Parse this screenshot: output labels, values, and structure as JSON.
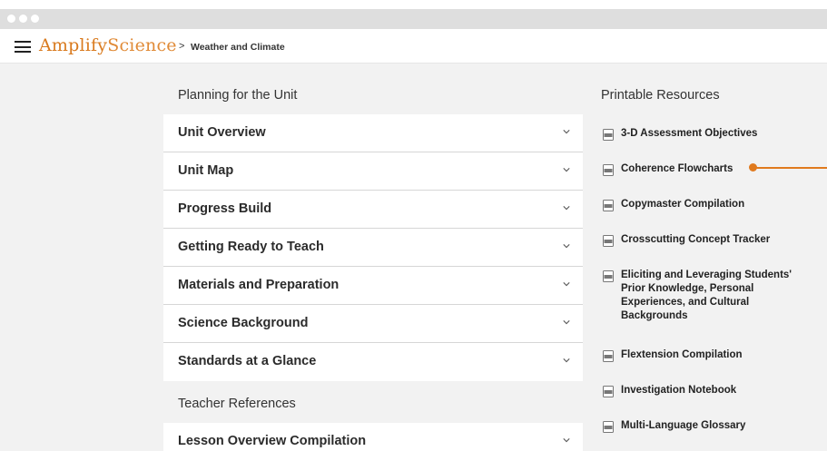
{
  "app": {
    "logo_primary": "Amplify",
    "logo_secondary": "Science",
    "breadcrumb_separator": ">",
    "breadcrumb": "Weather and Climate"
  },
  "planning": {
    "heading": "Planning for the Unit",
    "items": [
      {
        "label": "Unit Overview"
      },
      {
        "label": "Unit Map"
      },
      {
        "label": "Progress Build"
      },
      {
        "label": "Getting Ready to Teach"
      },
      {
        "label": "Materials and Preparation"
      },
      {
        "label": "Science Background"
      },
      {
        "label": "Standards at a Glance"
      }
    ]
  },
  "teacher": {
    "heading": "Teacher References",
    "items": [
      {
        "label": "Lesson Overview Compilation"
      }
    ]
  },
  "printable": {
    "heading": "Printable Resources",
    "items": [
      {
        "label": "3-D Assessment Objectives"
      },
      {
        "label": "Coherence Flowcharts"
      },
      {
        "label": "Copymaster Compilation"
      },
      {
        "label": "Crosscutting Concept Tracker"
      },
      {
        "label": "Eliciting and Leveraging Students' Prior Knowledge, Personal Experiences, and Cultural Backgrounds"
      },
      {
        "label": "Flextension Compilation"
      },
      {
        "label": "Investigation Notebook"
      },
      {
        "label": "Multi-Language Glossary"
      }
    ]
  },
  "colors": {
    "brand_orange": "#e07a1e",
    "panel_bg": "#f2f2f2"
  },
  "icons": {
    "menu": "hamburger-icon",
    "expand": "chevron-down-icon",
    "resource": "pdf-icon"
  }
}
